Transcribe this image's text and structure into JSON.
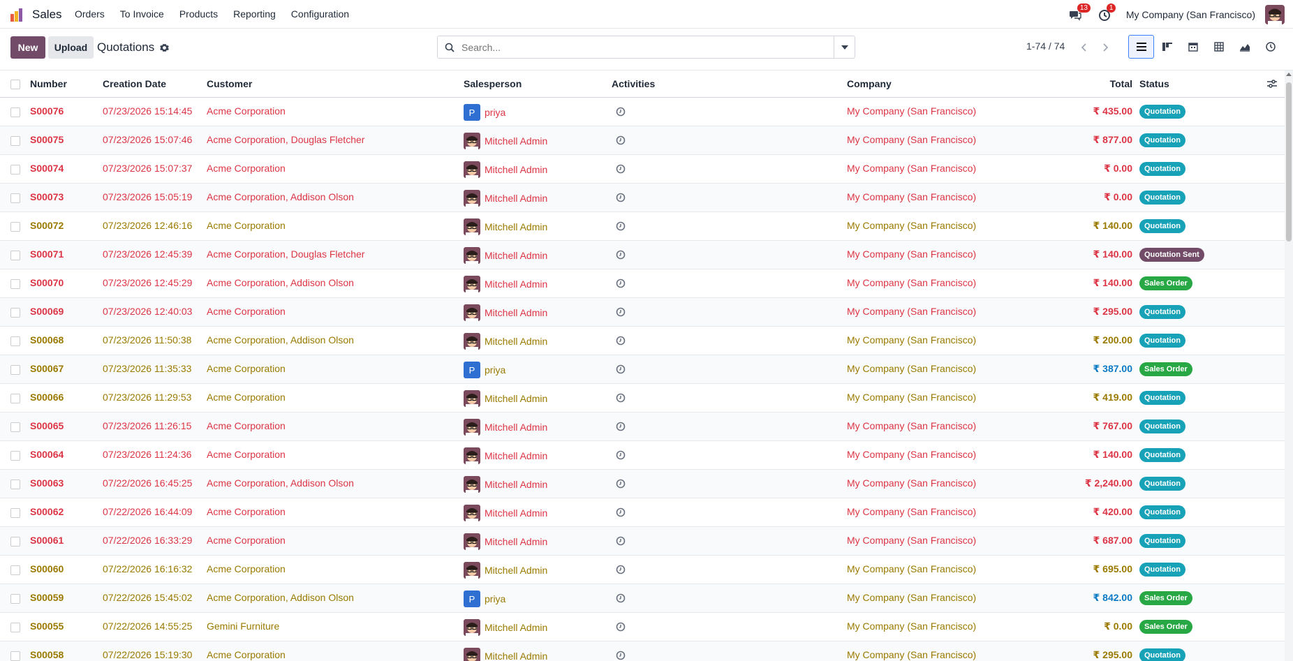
{
  "app": {
    "name": "Sales"
  },
  "menu": [
    "Orders",
    "To Invoice",
    "Products",
    "Reporting",
    "Configuration"
  ],
  "nav": {
    "messages_count": "13",
    "activities_count": "1",
    "company": "My Company (San Francisco)"
  },
  "control": {
    "new_label": "New",
    "upload_label": "Upload",
    "breadcrumb": "Quotations",
    "search_placeholder": "Search...",
    "pager": "1-74 / 74"
  },
  "columns": {
    "number": "Number",
    "creation_date": "Creation Date",
    "customer": "Customer",
    "salesperson": "Salesperson",
    "activities": "Activities",
    "company": "Company",
    "total": "Total",
    "status": "Status"
  },
  "colors": {
    "brand": "#714b67",
    "red": "#dc3545",
    "amber": "#9a7a00",
    "blue": "#0b7ac4",
    "quotation": "#17a2b8",
    "quotation_sent": "#714b67",
    "sales_order": "#28a745"
  },
  "rows": [
    {
      "number": "S00076",
      "date": "07/23/2026 15:14:45",
      "customer": "Acme Corporation",
      "sp": "priya",
      "sp_type": "letter",
      "sp_initial": "P",
      "company": "My Company (San Francisco)",
      "total": "₹ 435.00",
      "status": "Quotation",
      "tone": "red"
    },
    {
      "number": "S00075",
      "date": "07/23/2026 15:07:46",
      "customer": "Acme Corporation, Douglas Fletcher",
      "sp": "Mitchell Admin",
      "sp_type": "photo",
      "company": "My Company (San Francisco)",
      "total": "₹ 877.00",
      "status": "Quotation",
      "tone": "red"
    },
    {
      "number": "S00074",
      "date": "07/23/2026 15:07:37",
      "customer": "Acme Corporation",
      "sp": "Mitchell Admin",
      "sp_type": "photo",
      "company": "My Company (San Francisco)",
      "total": "₹ 0.00",
      "status": "Quotation",
      "tone": "red"
    },
    {
      "number": "S00073",
      "date": "07/23/2026 15:05:19",
      "customer": "Acme Corporation, Addison Olson",
      "sp": "Mitchell Admin",
      "sp_type": "photo",
      "company": "My Company (San Francisco)",
      "total": "₹ 0.00",
      "status": "Quotation",
      "tone": "red"
    },
    {
      "number": "S00072",
      "date": "07/23/2026 12:46:16",
      "customer": "Acme Corporation",
      "sp": "Mitchell Admin",
      "sp_type": "photo",
      "company": "My Company (San Francisco)",
      "total": "₹ 140.00",
      "status": "Quotation",
      "tone": "amber"
    },
    {
      "number": "S00071",
      "date": "07/23/2026 12:45:39",
      "customer": "Acme Corporation, Douglas Fletcher",
      "sp": "Mitchell Admin",
      "sp_type": "photo",
      "company": "My Company (San Francisco)",
      "total": "₹ 140.00",
      "status": "Quotation Sent",
      "tone": "red"
    },
    {
      "number": "S00070",
      "date": "07/23/2026 12:45:29",
      "customer": "Acme Corporation, Addison Olson",
      "sp": "Mitchell Admin",
      "sp_type": "photo",
      "company": "My Company (San Francisco)",
      "total": "₹ 140.00",
      "status": "Sales Order",
      "tone": "red"
    },
    {
      "number": "S00069",
      "date": "07/23/2026 12:40:03",
      "customer": "Acme Corporation",
      "sp": "Mitchell Admin",
      "sp_type": "photo",
      "company": "My Company (San Francisco)",
      "total": "₹ 295.00",
      "status": "Quotation",
      "tone": "red"
    },
    {
      "number": "S00068",
      "date": "07/23/2026 11:50:38",
      "customer": "Acme Corporation, Addison Olson",
      "sp": "Mitchell Admin",
      "sp_type": "photo",
      "company": "My Company (San Francisco)",
      "total": "₹ 200.00",
      "status": "Quotation",
      "tone": "amber"
    },
    {
      "number": "S00067",
      "date": "07/23/2026 11:35:33",
      "customer": "Acme Corporation",
      "sp": "priya",
      "sp_type": "letter",
      "sp_initial": "P",
      "company": "My Company (San Francisco)",
      "total": "₹ 387.00",
      "status": "Sales Order",
      "tone": "amber",
      "total_tone": "blue"
    },
    {
      "number": "S00066",
      "date": "07/23/2026 11:29:53",
      "customer": "Acme Corporation",
      "sp": "Mitchell Admin",
      "sp_type": "photo",
      "company": "My Company (San Francisco)",
      "total": "₹ 419.00",
      "status": "Quotation",
      "tone": "amber"
    },
    {
      "number": "S00065",
      "date": "07/23/2026 11:26:15",
      "customer": "Acme Corporation",
      "sp": "Mitchell Admin",
      "sp_type": "photo",
      "company": "My Company (San Francisco)",
      "total": "₹ 767.00",
      "status": "Quotation",
      "tone": "red"
    },
    {
      "number": "S00064",
      "date": "07/23/2026 11:24:36",
      "customer": "Acme Corporation",
      "sp": "Mitchell Admin",
      "sp_type": "photo",
      "company": "My Company (San Francisco)",
      "total": "₹ 140.00",
      "status": "Quotation",
      "tone": "red"
    },
    {
      "number": "S00063",
      "date": "07/22/2026 16:45:25",
      "customer": "Acme Corporation, Addison Olson",
      "sp": "Mitchell Admin",
      "sp_type": "photo",
      "company": "My Company (San Francisco)",
      "total": "₹ 2,240.00",
      "status": "Quotation",
      "tone": "red"
    },
    {
      "number": "S00062",
      "date": "07/22/2026 16:44:09",
      "customer": "Acme Corporation",
      "sp": "Mitchell Admin",
      "sp_type": "photo",
      "company": "My Company (San Francisco)",
      "total": "₹ 420.00",
      "status": "Quotation",
      "tone": "red"
    },
    {
      "number": "S00061",
      "date": "07/22/2026 16:33:29",
      "customer": "Acme Corporation",
      "sp": "Mitchell Admin",
      "sp_type": "photo",
      "company": "My Company (San Francisco)",
      "total": "₹ 687.00",
      "status": "Quotation",
      "tone": "red"
    },
    {
      "number": "S00060",
      "date": "07/22/2026 16:16:32",
      "customer": "Acme Corporation",
      "sp": "Mitchell Admin",
      "sp_type": "photo",
      "company": "My Company (San Francisco)",
      "total": "₹ 695.00",
      "status": "Quotation",
      "tone": "amber"
    },
    {
      "number": "S00059",
      "date": "07/22/2026 15:45:02",
      "customer": "Acme Corporation, Addison Olson",
      "sp": "priya",
      "sp_type": "letter",
      "sp_initial": "P",
      "company": "My Company (San Francisco)",
      "total": "₹ 842.00",
      "status": "Sales Order",
      "tone": "amber",
      "total_tone": "blue"
    },
    {
      "number": "S00055",
      "date": "07/22/2026 14:55:25",
      "customer": "Gemini Furniture",
      "sp": "Mitchell Admin",
      "sp_type": "photo",
      "company": "My Company (San Francisco)",
      "total": "₹ 0.00",
      "status": "Sales Order",
      "tone": "amber"
    },
    {
      "number": "S00058",
      "date": "07/22/2026 15:19:30",
      "customer": "Acme Corporation",
      "sp": "Mitchell Admin",
      "sp_type": "photo",
      "company": "My Company (San Francisco)",
      "total": "₹ 295.00",
      "status": "Quotation",
      "tone": "amber"
    }
  ]
}
